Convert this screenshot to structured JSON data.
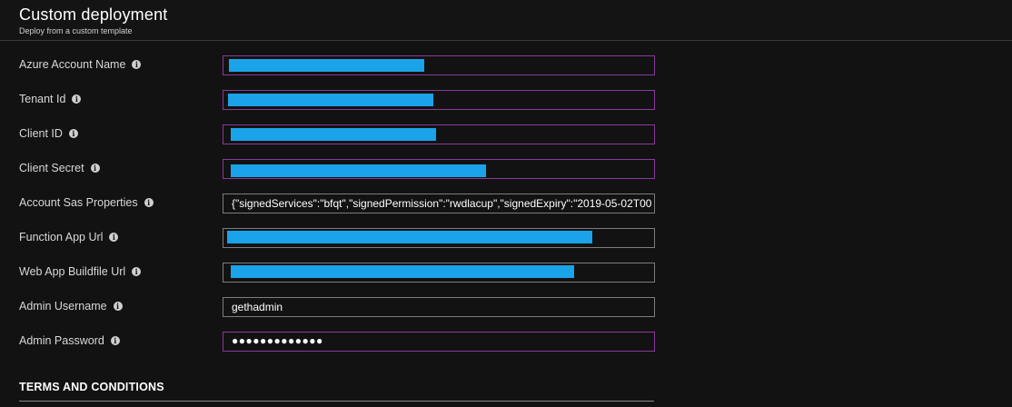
{
  "header": {
    "title": "Custom deployment",
    "subtitle": "Deploy from a custom template"
  },
  "fields": [
    {
      "label": "Azure Account Name",
      "value": "",
      "redacted": true,
      "border": "#8a3a9c"
    },
    {
      "label": "Tenant Id",
      "value": "",
      "redacted": true,
      "border": "#8a3a9c"
    },
    {
      "label": "Client ID",
      "value": "",
      "redacted": true,
      "border": "#8a3a9c"
    },
    {
      "label": "Client Secret",
      "value": "",
      "redacted": true,
      "border": "#8a3a9c"
    },
    {
      "label": "Account Sas Properties",
      "value": "{\"signedServices\":\"bfqt\",\"signedPermission\":\"rwdlacup\",\"signedExpiry\":\"2019-05-02T00",
      "redacted": false,
      "border": "#7d7d7d"
    },
    {
      "label": "Function App Url",
      "value": "",
      "redacted": true,
      "border": "#7d7d7d"
    },
    {
      "label": "Web App Buildfile Url",
      "value": "",
      "redacted": true,
      "border": "#7d7d7d"
    },
    {
      "label": "Admin Username",
      "value": "gethadmin",
      "redacted": false,
      "border": "#7d7d7d"
    },
    {
      "label": "Admin Password",
      "value": "●●●●●●●●●●●●●",
      "redacted": false,
      "border": "#8a3a9c"
    }
  ],
  "info_icon": "info-circle-icon",
  "section": {
    "title": "TERMS AND CONDITIONS"
  },
  "colors": {
    "background": "#121212",
    "invalid_border": "#8a3a9c",
    "default_border": "#7d7d7d",
    "redaction": "#1aa3e8"
  }
}
